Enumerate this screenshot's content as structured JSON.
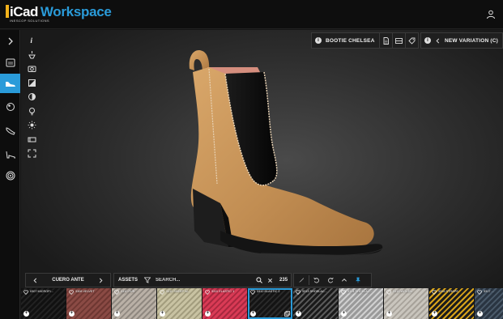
{
  "header": {
    "logo_primary": "iCad",
    "logo_secondary": "Workspace",
    "logo_sub": "INESCOP SOLUTIONS"
  },
  "rail": {
    "items": [
      {
        "name": "expand-icon"
      },
      {
        "name": "last-mould-icon"
      },
      {
        "name": "shoe-design-icon",
        "active": true
      },
      {
        "name": "pattern-icon"
      },
      {
        "name": "sole-icon"
      },
      {
        "name": "heel-icon"
      },
      {
        "name": "target-icon"
      }
    ]
  },
  "tools": [
    "info-icon",
    "lighting-icon",
    "camera-icon",
    "color-mode-icon",
    "contrast-icon",
    "light-bulb-icon",
    "sun-icon",
    "panel-icon",
    "fullscreen-icon"
  ],
  "topbar": {
    "model_label": "BOOTIE CHELSEA",
    "variation_label": "NEW VARIATION (C)"
  },
  "materials_bar": {
    "category_label": "CUERO ANTE"
  },
  "assets_bar": {
    "assets_label": "ASSETS",
    "search_placeholder": "SEARCH...",
    "count": "235"
  },
  "materials": [
    {
      "label": "0307 MICROFI...",
      "color1": "#111111",
      "color2": "#222222"
    },
    {
      "label": "3308 VELVET",
      "color1": "#8a4a44",
      "color2": "#6e3732"
    },
    {
      "label": "3310 FUR",
      "color1": "#b9b0a6",
      "color2": "#8f8880"
    },
    {
      "label": "3311 SHEEP W...",
      "color1": "#c8c2a2",
      "color2": "#a39d7e"
    },
    {
      "label": "3311 ELASTIC 1",
      "color1": "#d93a55",
      "color2": "#a8283f"
    },
    {
      "label": "3312 ELASTIC 2",
      "color1": "#141414",
      "color2": "#2a2a2a",
      "selected": true
    },
    {
      "label": "3313 SHOELAC...",
      "color1": "#1a1a1a",
      "color2": "#5a5a5a"
    },
    {
      "label": "3314 SHOELAC...",
      "color1": "#9a9a9a",
      "color2": "#d0d0d0"
    },
    {
      "label": "3315 WOVEN",
      "color1": "#c9c5bd",
      "color2": "#a7a29a"
    },
    {
      "label": "3316 STRAPS",
      "color1": "#1c1c1c",
      "color2": "#d9a41a"
    },
    {
      "label": "3317 ...",
      "color1": "#2a3542",
      "color2": "#4a5a6a"
    }
  ]
}
